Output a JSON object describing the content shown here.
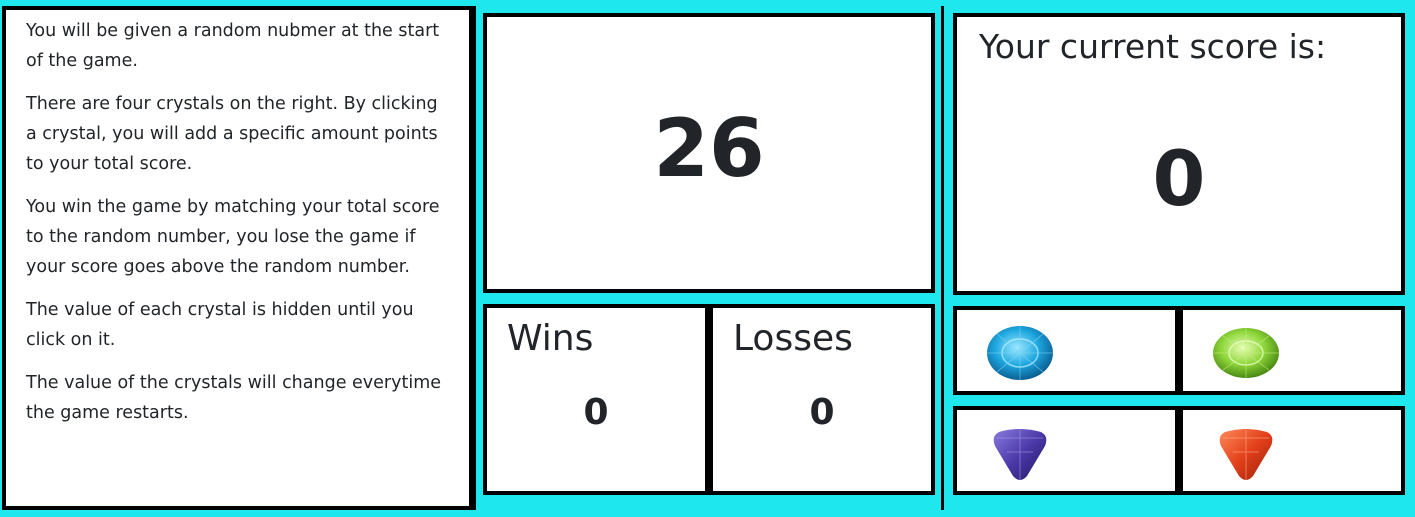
{
  "instructions": {
    "paragraphs": [
      "You will be given a random nubmer at the start of the game.",
      "There are four crystals on the right. By clicking a crystal, you will add a specific amount points to your total score.",
      "You win the game by matching your total score to the random number, you lose the game if your score goes above the random number.",
      "The value of each crystal is hidden until you click on it.",
      "The value of the crystals will change everytime the game restarts."
    ]
  },
  "target": {
    "number": "26"
  },
  "stats": {
    "wins_label": "Wins",
    "wins_value": "0",
    "losses_label": "Losses",
    "losses_value": "0"
  },
  "score": {
    "title": "Your current score is:",
    "value": "0"
  },
  "crystals": [
    {
      "icon": "blue-oval-crystal-icon",
      "color": "#1ea7e0"
    },
    {
      "icon": "green-oval-crystal-icon",
      "color": "#8ed63a"
    },
    {
      "icon": "purple-trillion-crystal-icon",
      "color": "#4b3aa8"
    },
    {
      "icon": "red-trillion-crystal-icon",
      "color": "#e2401a"
    }
  ],
  "colors": {
    "background": "#1ee8ee",
    "border": "#000000"
  }
}
